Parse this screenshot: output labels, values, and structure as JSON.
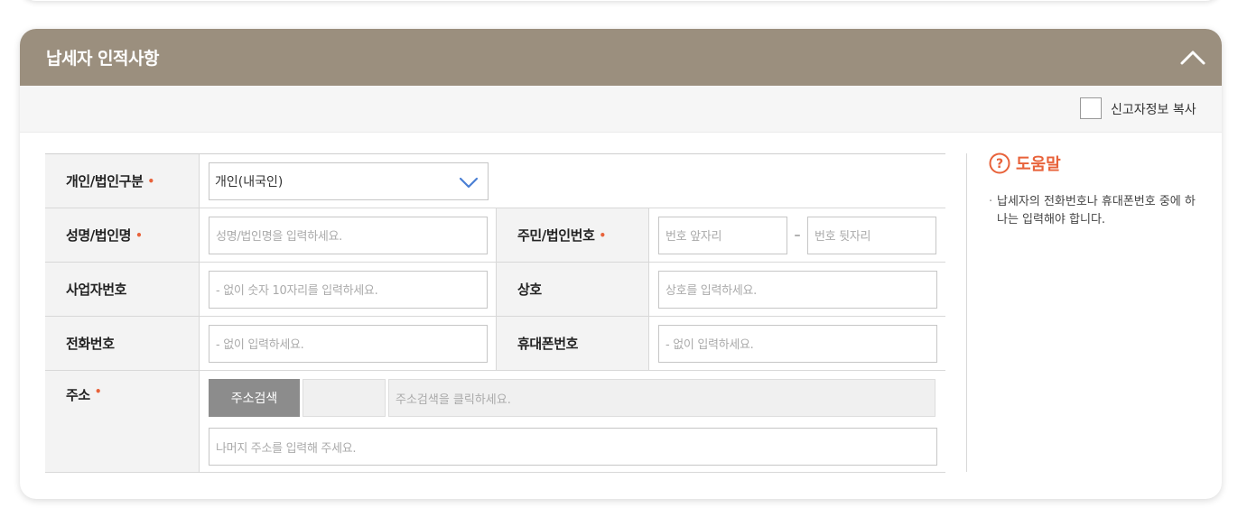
{
  "section": {
    "title": "납세자 인적사항",
    "copy_label": "신고자정보 복사"
  },
  "form": {
    "type_label": "개인/법인구분",
    "type_value": "개인(내국인)",
    "name_label": "성명/법인명",
    "name_placeholder": "성명/법인명을 입력하세요.",
    "idnum_label": "주민/법인번호",
    "idnum_front_placeholder": "번호 앞자리",
    "idnum_sep": "–",
    "idnum_back_placeholder": "번호 뒷자리",
    "bizno_label": "사업자번호",
    "bizno_placeholder": "- 없이 숫자 10자리를 입력하세요.",
    "company_label": "상호",
    "company_placeholder": "상호를 입력하세요.",
    "phone_label": "전화번호",
    "phone_placeholder": "- 없이 입력하세요.",
    "mobile_label": "휴대폰번호",
    "mobile_placeholder": "- 없이 입력하세요.",
    "address_label": "주소",
    "address_search_button": "주소검색",
    "address_main_placeholder": "주소검색을 클릭하세요.",
    "address_detail_placeholder": "나머지 주소를 입력해 주세요.",
    "required_mark": "•"
  },
  "help": {
    "title": "도움말",
    "text": "납세자의 전화번호나 휴대폰번호 중에 하나는 입력해야 합니다."
  },
  "colors": {
    "header_bg": "#9b8f7e",
    "accent": "#e8623a",
    "chevron": "#4a7fd4"
  }
}
